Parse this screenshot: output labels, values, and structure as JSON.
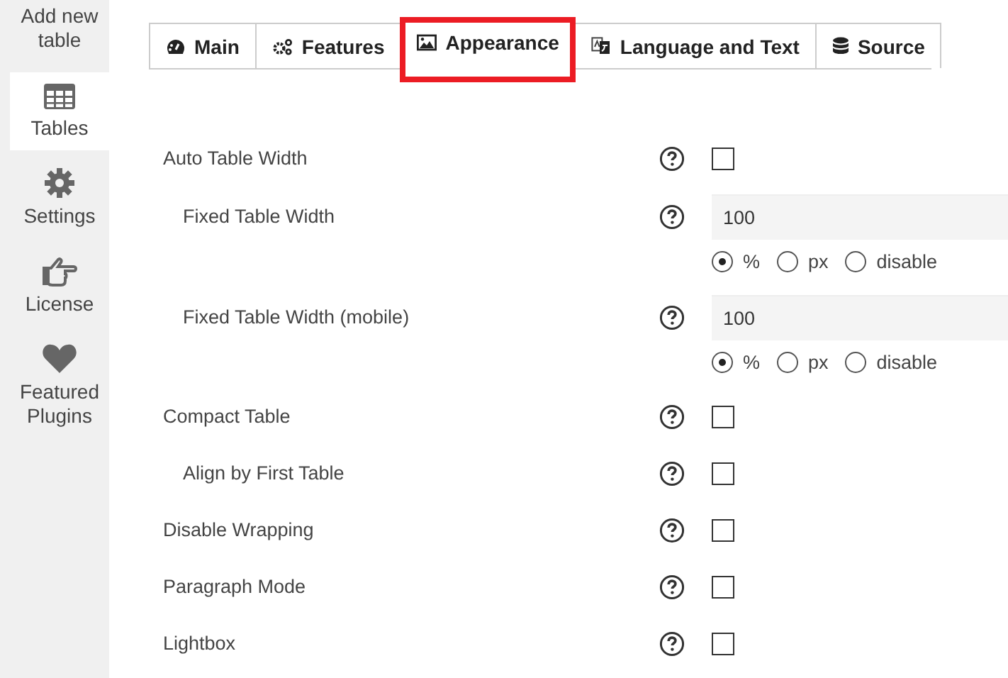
{
  "sidebar": {
    "items": [
      {
        "label": "Add new table",
        "selected": false
      },
      {
        "label": "Tables",
        "selected": true
      },
      {
        "label": "Settings",
        "selected": false
      },
      {
        "label": "License",
        "selected": false
      },
      {
        "label": "Featured Plugins",
        "selected": false
      }
    ]
  },
  "tabs": [
    {
      "label": "Main",
      "highlighted": false
    },
    {
      "label": "Features",
      "highlighted": false
    },
    {
      "label": "Appearance",
      "highlighted": true
    },
    {
      "label": "Language and Text",
      "highlighted": false
    },
    {
      "label": "Source",
      "highlighted": false
    }
  ],
  "settings": [
    {
      "label": "Auto Table Width",
      "kind": "checkbox",
      "checked": false,
      "children": [
        {
          "label": "Fixed Table Width",
          "kind": "number",
          "value": "100",
          "options": [
            {
              "label": "%",
              "selected": true
            },
            {
              "label": "px",
              "selected": false
            },
            {
              "label": "disable",
              "selected": false
            }
          ]
        },
        {
          "label": "Fixed Table Width (mobile)",
          "kind": "number",
          "value": "100",
          "options": [
            {
              "label": "%",
              "selected": true
            },
            {
              "label": "px",
              "selected": false
            },
            {
              "label": "disable",
              "selected": false
            }
          ]
        }
      ]
    },
    {
      "label": "Compact Table",
      "kind": "checkbox",
      "checked": false,
      "children": [
        {
          "label": "Align by First Table",
          "kind": "checkbox",
          "checked": false
        }
      ]
    },
    {
      "label": "Disable Wrapping",
      "kind": "checkbox",
      "checked": false
    },
    {
      "label": "Paragraph Mode",
      "kind": "checkbox",
      "checked": false
    },
    {
      "label": "Lightbox",
      "kind": "checkbox",
      "checked": false
    }
  ]
}
